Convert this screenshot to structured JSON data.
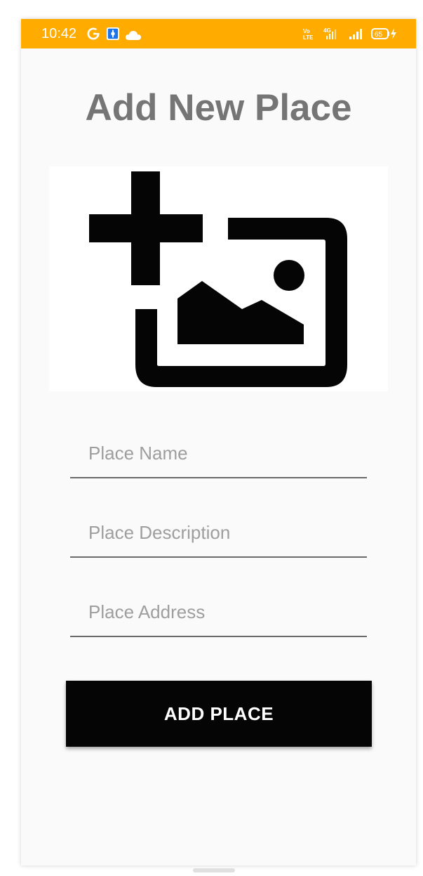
{
  "status_bar": {
    "time": "10:42",
    "icons_left": [
      "google-icon",
      "app-icon",
      "cloud-icon"
    ],
    "icons_right": [
      "volte-icon",
      "4g-signal-icon",
      "signal-icon",
      "battery-icon"
    ],
    "battery_level": "65",
    "background_color": "#ffab00"
  },
  "page": {
    "title": "Add New Place",
    "title_color": "#757575"
  },
  "image_picker": {
    "icon": "add-photo-icon"
  },
  "form": {
    "place_name": {
      "value": "",
      "placeholder": "Place Name"
    },
    "place_description": {
      "value": "",
      "placeholder": "Place Description"
    },
    "place_address": {
      "value": "",
      "placeholder": "Place Address"
    }
  },
  "actions": {
    "add_place_label": "ADD PLACE",
    "button_color": "#050505"
  }
}
